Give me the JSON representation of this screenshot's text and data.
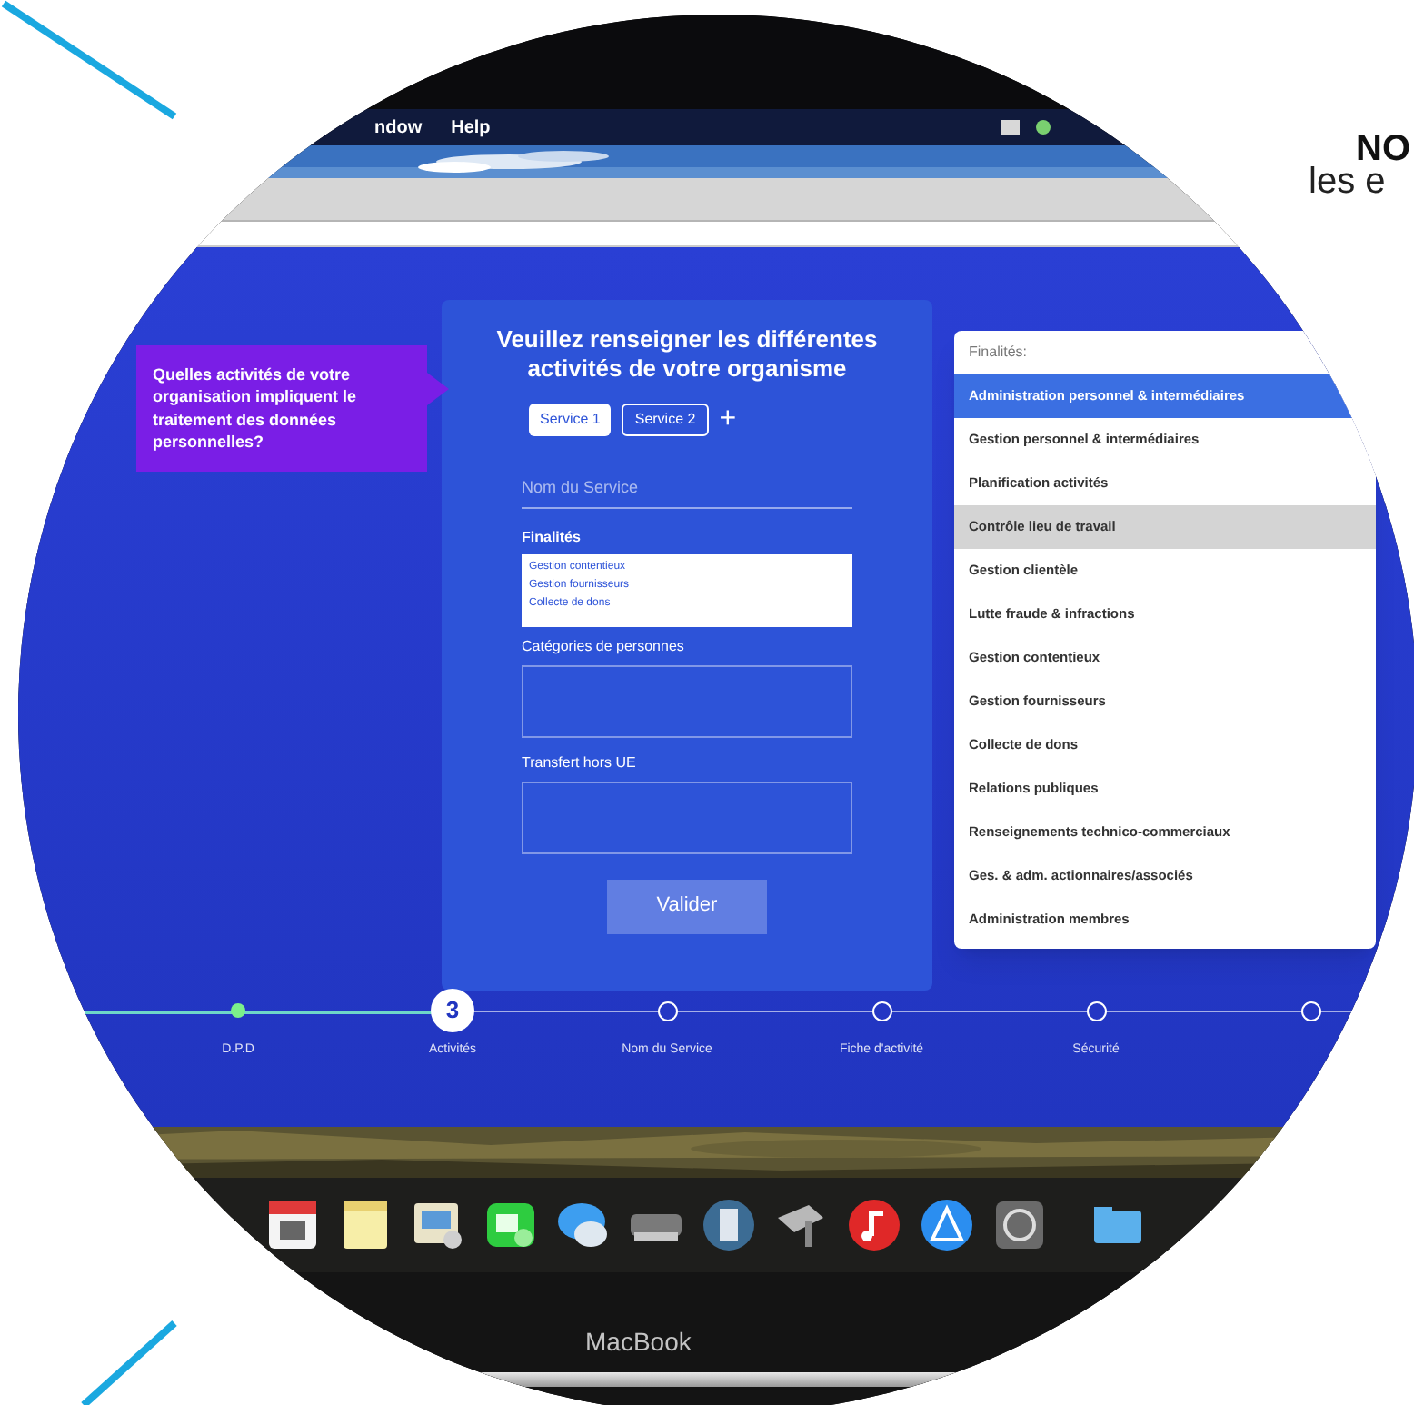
{
  "page_text": {
    "heading": "NO",
    "line": "les e"
  },
  "menu_bar": {
    "items": [
      "ndow",
      "Help"
    ]
  },
  "tooltip": "Quelles activités de votre organisation impliquent le traitement des données personnelles?",
  "form": {
    "title": "Veuillez renseigner les différentes activités de votre organisme",
    "tabs": [
      {
        "label": "Service 1",
        "selected": true
      },
      {
        "label": "Service 2",
        "selected": false
      }
    ],
    "add": "+",
    "name_field": {
      "placeholder": "Nom du Service"
    },
    "finalites": {
      "label": "Finalités",
      "items": [
        "Gestion contentieux",
        "Gestion fournisseurs",
        "Collecte de dons"
      ]
    },
    "categories": {
      "label": "Catégories de personnes"
    },
    "transfert": {
      "label": "Transfert hors UE"
    },
    "submit": "Valider"
  },
  "dropdown": {
    "header": "Finalités:",
    "options": [
      {
        "label": "Administration personnel & intermédiaires",
        "selected": true,
        "highlighted": false
      },
      {
        "label": "Gestion personnel & intermédiaires",
        "selected": false,
        "highlighted": false
      },
      {
        "label": "Planification activités",
        "selected": false,
        "highlighted": false
      },
      {
        "label": "Contrôle lieu de travail",
        "selected": false,
        "highlighted": true
      },
      {
        "label": "Gestion clientèle",
        "selected": false,
        "highlighted": false
      },
      {
        "label": "Lutte fraude & infractions",
        "selected": false,
        "highlighted": false
      },
      {
        "label": "Gestion contentieux",
        "selected": false,
        "highlighted": false
      },
      {
        "label": "Gestion fournisseurs",
        "selected": false,
        "highlighted": false
      },
      {
        "label": "Collecte de dons",
        "selected": false,
        "highlighted": false
      },
      {
        "label": "Relations publiques",
        "selected": false,
        "highlighted": false
      },
      {
        "label": "Renseignements technico-commerciaux",
        "selected": false,
        "highlighted": false
      },
      {
        "label": "Ges. & adm. actionnaires/associés",
        "selected": false,
        "highlighted": false
      },
      {
        "label": "Administration membres",
        "selected": false,
        "highlighted": false
      }
    ]
  },
  "steps": [
    {
      "label": "D.P.D",
      "kind": "done"
    },
    {
      "label": "Activités",
      "kind": "current",
      "number": "3"
    },
    {
      "label": "Nom du Service",
      "kind": "todo"
    },
    {
      "label": "Fiche d'activité",
      "kind": "todo"
    },
    {
      "label": "Sécurité",
      "kind": "todo"
    },
    {
      "kind": "todo"
    }
  ],
  "laptop_label": "MacBook"
}
